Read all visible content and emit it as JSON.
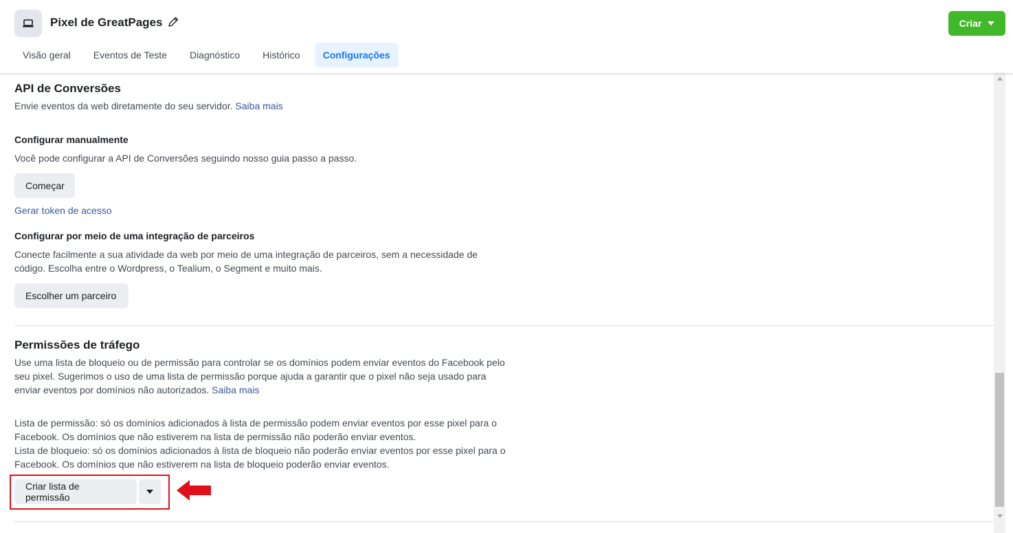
{
  "header": {
    "title": "Pixel de GreatPages",
    "create_button": "Criar",
    "tabs": [
      "Visão geral",
      "Eventos de Teste",
      "Diagnóstico",
      "Histórico",
      "Configurações"
    ],
    "active_tab": "Configurações"
  },
  "conversions_api": {
    "title": "API de Conversões",
    "description": "Envie eventos da web diretamente do seu servidor.",
    "learn_more": "Saiba mais",
    "manual": {
      "heading": "Configurar manualmente",
      "text": "Você pode configurar a API de Conversões seguindo nosso guia passo a passo.",
      "start_button": "Começar",
      "token_link": "Gerar token de acesso"
    },
    "partner": {
      "heading": "Configurar por meio de uma integração de parceiros",
      "text": "Conecte facilmente a sua atividade da web por meio de uma integração de parceiros, sem a necessidade de código. Escolha entre o Wordpress, o Tealium, o Segment e muito mais.",
      "button": "Escolher um parceiro"
    }
  },
  "traffic": {
    "title": "Permissões de tráfego",
    "description": "Use uma lista de bloqueio ou de permissão para controlar se os domínios podem enviar eventos do Facebook pelo seu pixel. Sugerimos o uso de uma lista de permissão porque ajuda a garantir que o pixel não seja usado para enviar eventos por domínios não autorizados.",
    "learn_more": "Saiba mais",
    "allow_text": "Lista de permissão: só os domínios adicionados à lista de permissão podem enviar eventos por esse pixel para o Facebook. Os domínios que não estiverem na lista de permissão não poderão enviar eventos.",
    "block_text": "Lista de bloqueio: só os domínios adicionados à lista de bloqueio não poderão enviar eventos por esse pixel para o Facebook. Os domínios que não estiverem na lista de bloqueio poderão enviar eventos.",
    "create_button": "Criar lista de permissão"
  },
  "colors": {
    "accent": "#1877f2",
    "create_green": "#42b72a",
    "link": "#385898",
    "annotation_red": "#e0101a"
  }
}
